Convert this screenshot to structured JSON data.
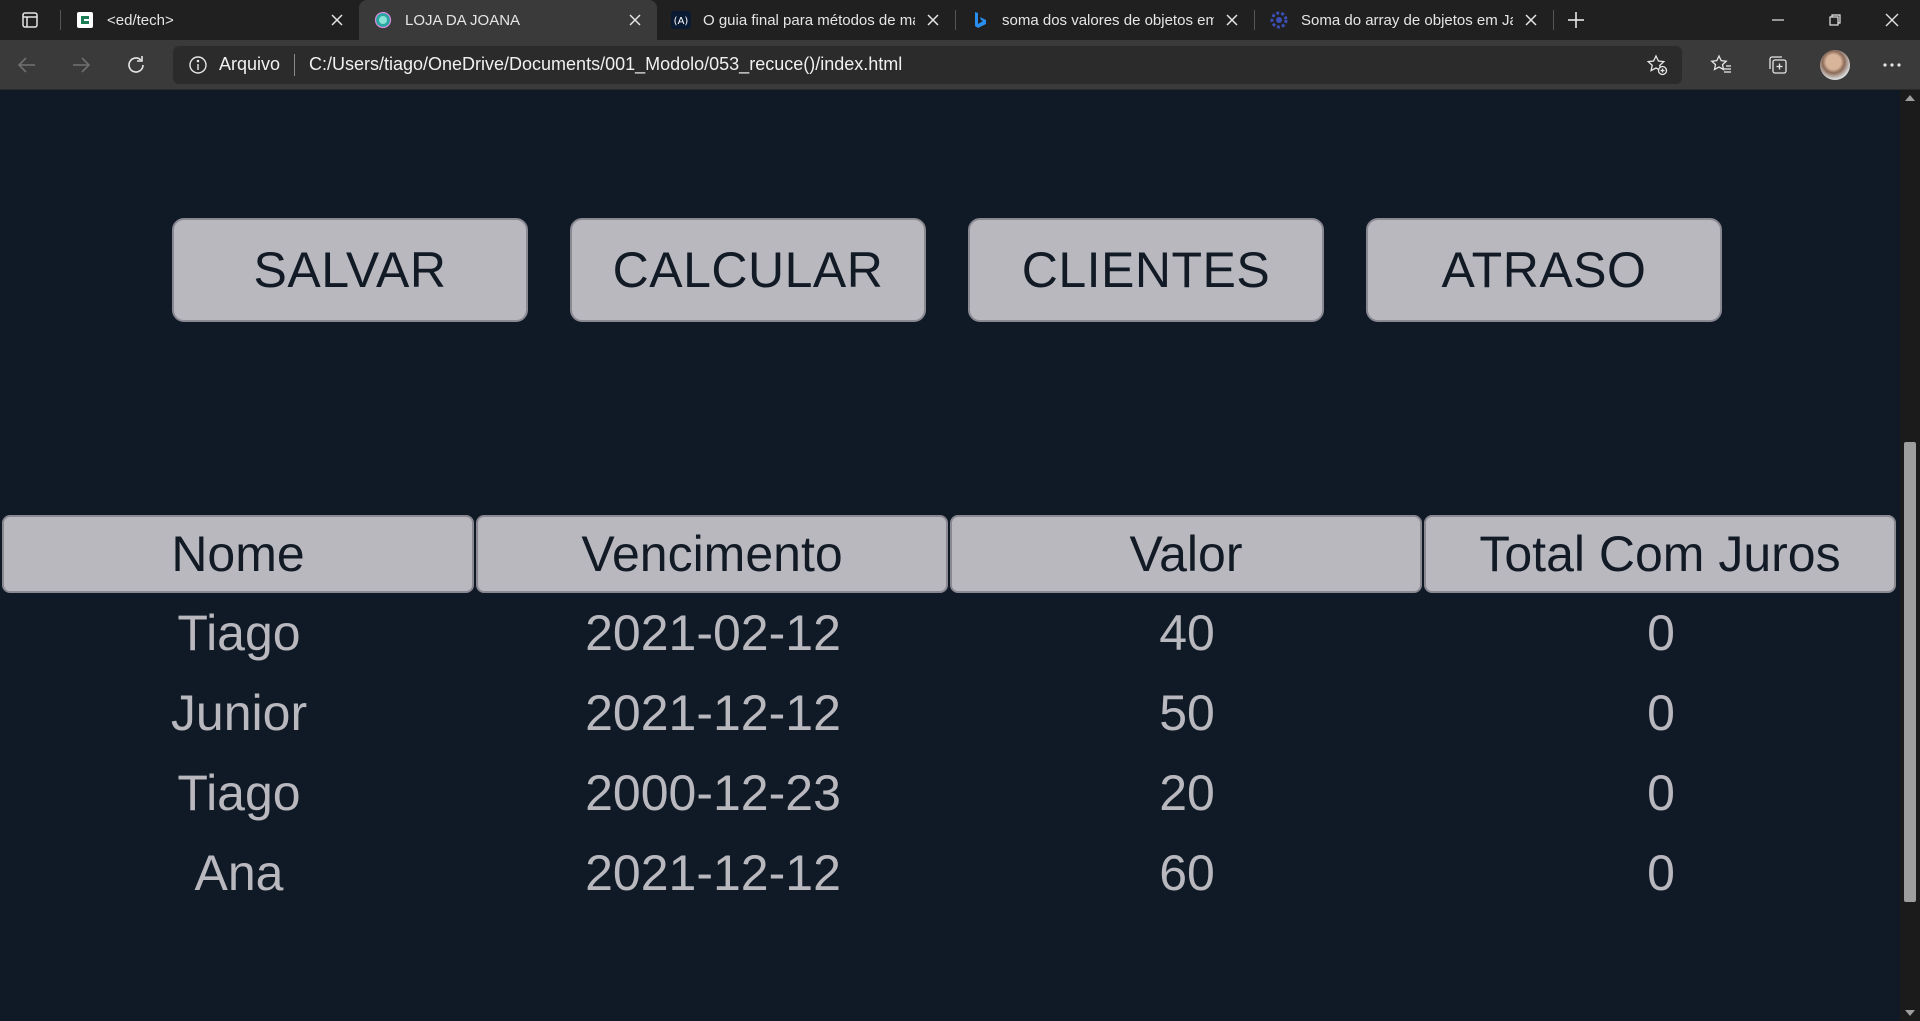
{
  "browser": {
    "tabs": [
      {
        "title": "<ed/tech>",
        "icon": "edtech-favicon",
        "active": false
      },
      {
        "title": "LOJA DA JOANA",
        "icon": "globe-favicon",
        "active": true
      },
      {
        "title": "O guia final para métodos de ma",
        "icon": "alura-favicon",
        "active": false
      },
      {
        "title": "soma dos valores de objetos em",
        "icon": "bing-favicon",
        "active": false
      },
      {
        "title": "Soma do array de objetos em Ja",
        "icon": "gear-favicon",
        "active": false
      }
    ],
    "address": {
      "label": "Arquivo",
      "url": "C:/Users/tiago/OneDrive/Documents/001_Modolo/053_recuce()/index.html"
    }
  },
  "page": {
    "buttons": {
      "save": "SALVAR",
      "calculate": "CALCULAR",
      "clients": "CLIENTES",
      "late": "ATRASO"
    },
    "table": {
      "headers": [
        "Nome",
        "Vencimento",
        "Valor",
        "Total Com Juros"
      ],
      "rows": [
        [
          "Tiago",
          "2021-02-12",
          "40",
          "0"
        ],
        [
          "Junior",
          "2021-12-12",
          "50",
          "0"
        ],
        [
          "Tiago",
          "2000-12-23",
          "20",
          "0"
        ],
        [
          "Ana",
          "2021-12-12",
          "60",
          "0"
        ]
      ]
    }
  }
}
